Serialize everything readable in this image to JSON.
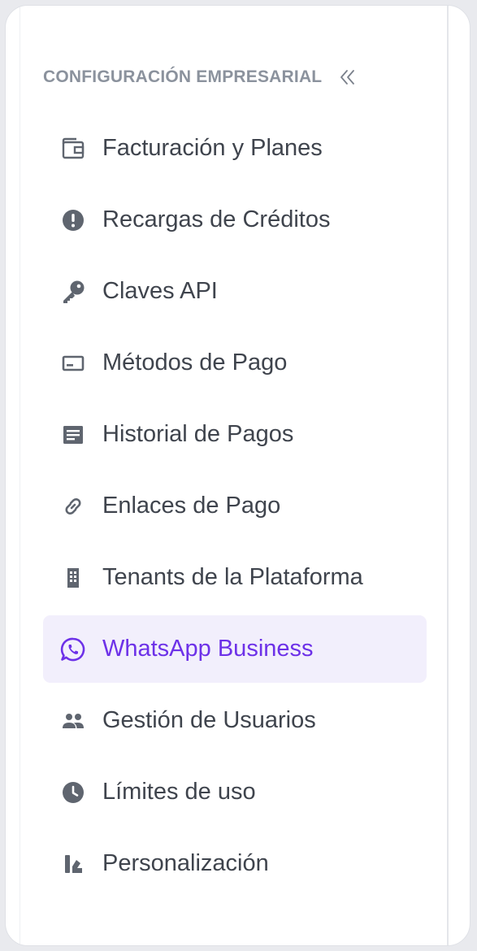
{
  "section": {
    "title": "CONFIGURACIÓN EMPRESARIAL",
    "collapse_icon": "double-chevron-left-icon"
  },
  "menu": {
    "active_index": 7,
    "items": [
      {
        "label": "Facturación y Planes",
        "icon": "wallet-icon"
      },
      {
        "label": "Recargas de Créditos",
        "icon": "exclamation-circle-icon"
      },
      {
        "label": "Claves API",
        "icon": "key-icon"
      },
      {
        "label": "Métodos de Pago",
        "icon": "card-icon"
      },
      {
        "label": "Historial de Pagos",
        "icon": "document-list-icon"
      },
      {
        "label": "Enlaces de Pago",
        "icon": "link-icon"
      },
      {
        "label": "Tenants de la Plataforma",
        "icon": "building-icon"
      },
      {
        "label": "WhatsApp Business",
        "icon": "whatsapp-icon"
      },
      {
        "label": "Gestión de Usuarios",
        "icon": "users-icon"
      },
      {
        "label": "Límites de uso",
        "icon": "clock-icon"
      },
      {
        "label": "Personalización",
        "icon": "brush-icon"
      }
    ]
  },
  "colors": {
    "text": "#3f444d",
    "icon": "#5f656f",
    "active_text": "#6d31e8",
    "active_bg": "#f2effc",
    "section_title": "#8b929d"
  }
}
